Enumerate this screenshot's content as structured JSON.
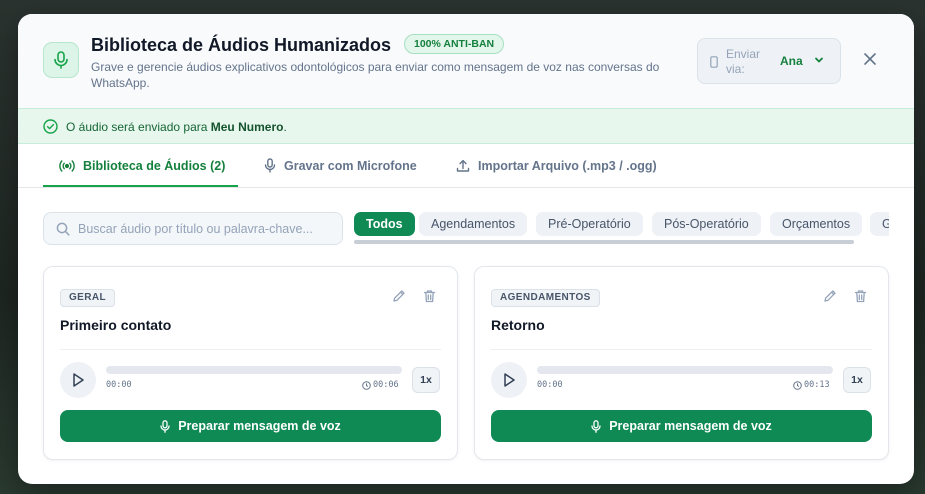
{
  "colors": {
    "brand": "#0f8a55",
    "brand_text": "#15803d",
    "notice_bg": "#e7f7ee",
    "muted": "#64748b"
  },
  "header": {
    "icon": "microphone-icon",
    "title": "Biblioteca de Áudios Humanizados",
    "badge": "100% ANTI-BAN",
    "subtitle": "Grave e gerencie áudios explicativos odontológicos para enviar como mensagem de voz nas conversas do WhatsApp.",
    "sender_label": "Enviar via:",
    "sender_value": "Ana",
    "sender_icon": "phone-icon",
    "close_icon": "close-icon"
  },
  "notice": {
    "icon": "check-circle-icon",
    "prefix": "O áudio será enviado para ",
    "target": "Meu Numero",
    "suffix": "."
  },
  "tabs": [
    {
      "label": "Biblioteca de Áudios (2)",
      "icon": "broadcast-icon",
      "active": true
    },
    {
      "label": "Gravar com Microfone",
      "icon": "microphone-icon",
      "active": false
    },
    {
      "label": "Importar Arquivo (.mp3 / .ogg)",
      "icon": "upload-icon",
      "active": false
    }
  ],
  "search": {
    "placeholder": "Buscar áudio por título ou palavra-chave...",
    "value": ""
  },
  "filters": [
    {
      "label": "Todos",
      "active": true
    },
    {
      "label": "Agendamentos",
      "active": false
    },
    {
      "label": "Pré-Operatório",
      "active": false
    },
    {
      "label": "Pós-Operatório",
      "active": false
    },
    {
      "label": "Orçamentos",
      "active": false
    },
    {
      "label": "G",
      "active": false
    }
  ],
  "cards": [
    {
      "category": "GERAL",
      "title": "Primeiro contato",
      "current_time": "00:00",
      "duration": "00:06",
      "speed": "1x",
      "progress": 0,
      "button_label": "Preparar mensagem de voz"
    },
    {
      "category": "AGENDAMENTOS",
      "title": "Retorno",
      "current_time": "00:00",
      "duration": "00:13",
      "speed": "1x",
      "progress": 0,
      "button_label": "Preparar mensagem de voz"
    }
  ]
}
